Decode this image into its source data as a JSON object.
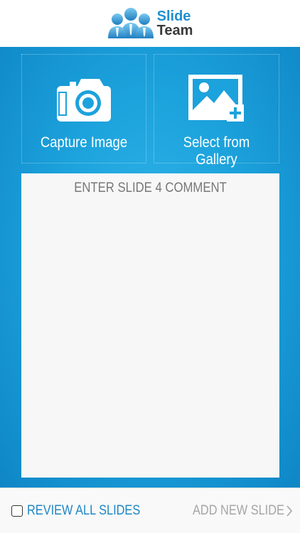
{
  "header": {
    "logo_line1": "Slide",
    "logo_line2": "Team"
  },
  "actions": {
    "capture_label": "Capture Image",
    "gallery_label": "Select from Gallery"
  },
  "comment": {
    "placeholder": "ENTER SLIDE 4 COMMENT",
    "value": ""
  },
  "footer": {
    "review_label": "REVIEW ALL SLIDES",
    "review_checked": false,
    "add_label": "ADD NEW SLIDE"
  },
  "icons": {
    "logo": "people-group-icon",
    "capture": "camera-icon",
    "gallery": "image-add-icon",
    "review": "checkbox-icon",
    "add": "chevron-right-icon"
  },
  "colors": {
    "brand_blue": "#1f8fd0",
    "panel_blue": "#1ca2dc",
    "review_text": "#1f86c4",
    "add_text": "#a5a5a5"
  }
}
